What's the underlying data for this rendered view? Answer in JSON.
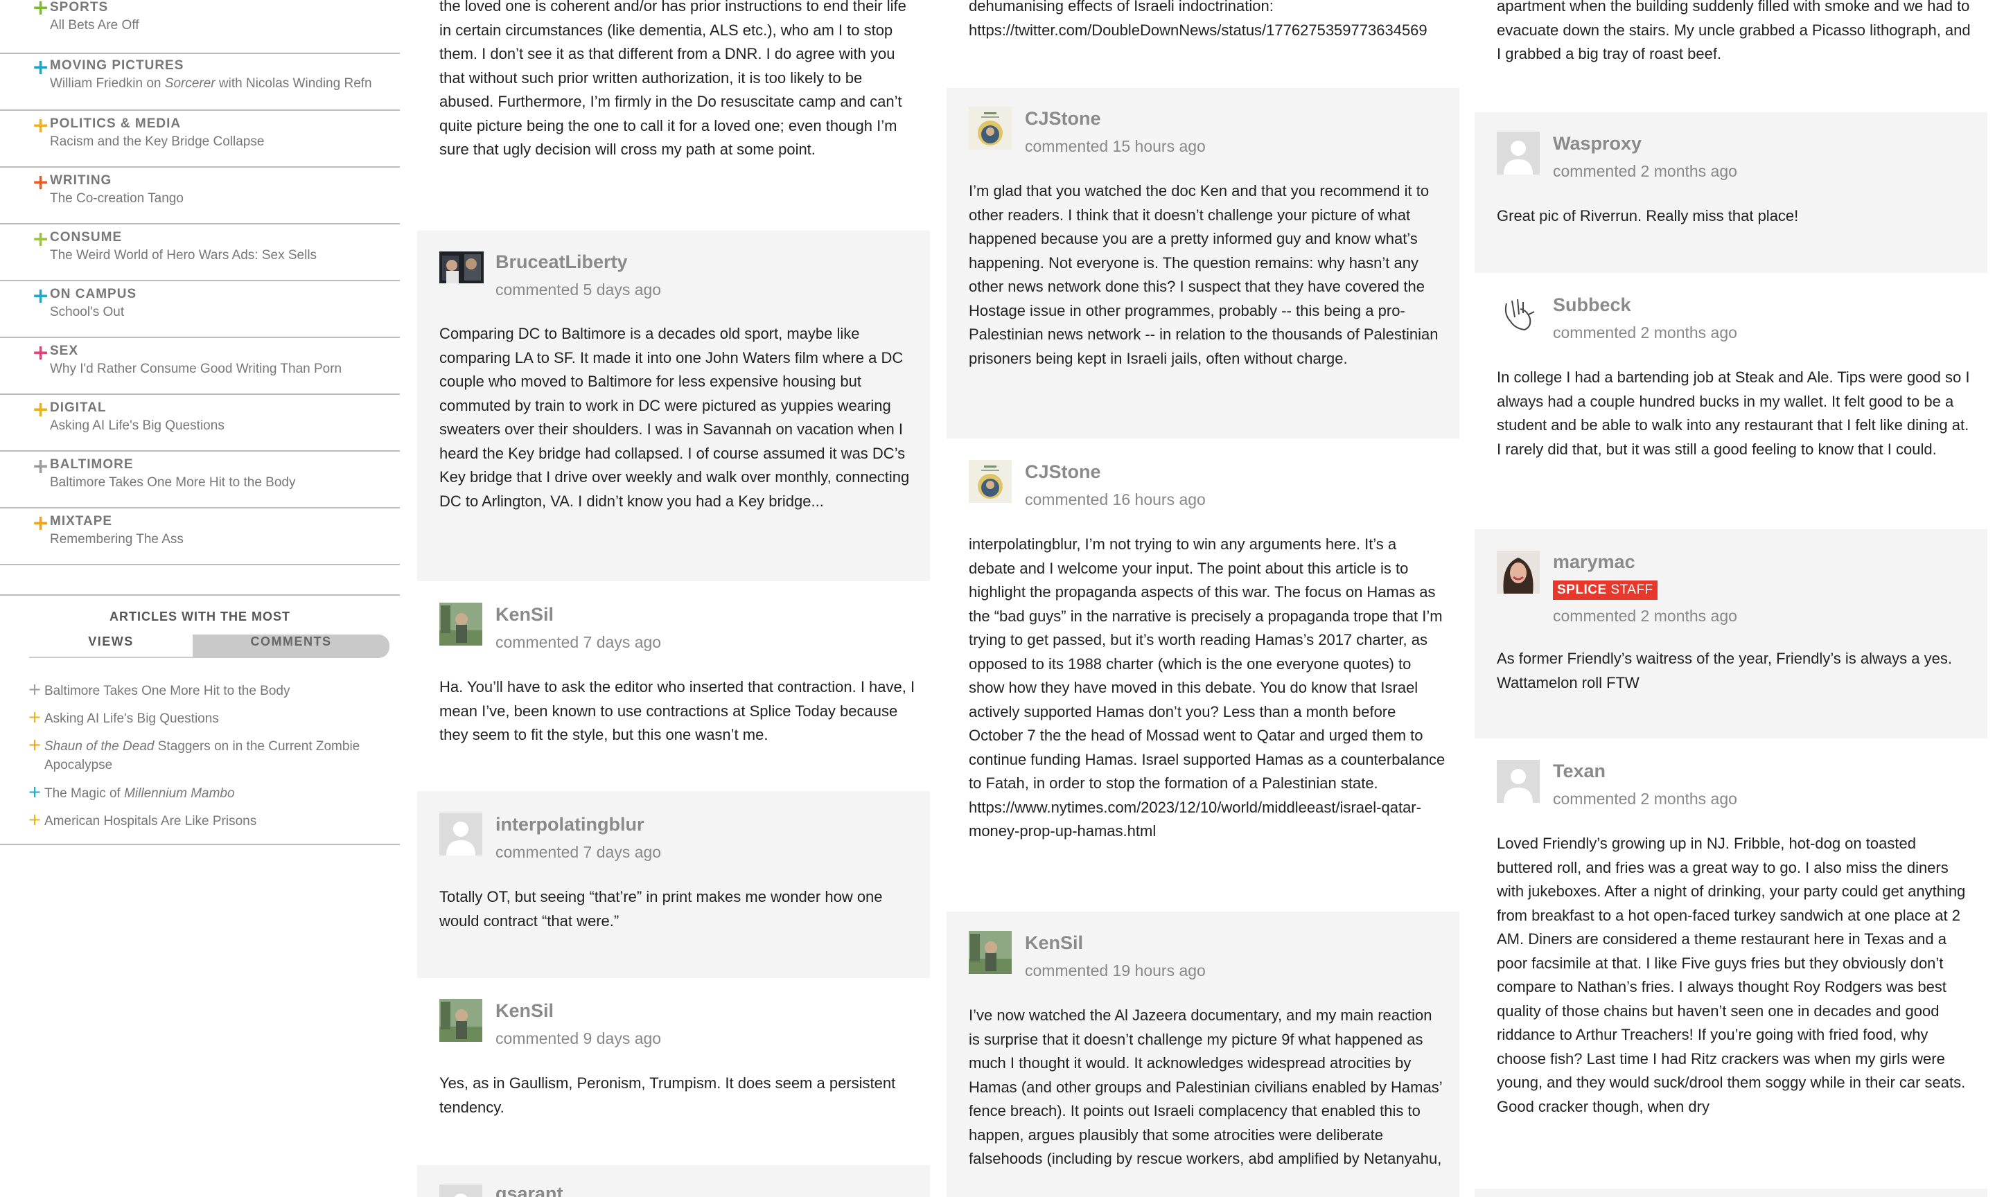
{
  "sidebar": {
    "sections": [
      {
        "category": "SPORTS",
        "title": "All Bets Are Off",
        "accent": "#7cba2f"
      },
      {
        "category": "MOVING PICTURES",
        "title_pre": "William Friedkin on ",
        "title_em": "Sorcerer",
        "title_post": " with Nicolas Winding Refn",
        "accent": "#1aa6c9"
      },
      {
        "category": "POLITICS & MEDIA",
        "title": "Racism and the Key Bridge Collapse",
        "accent": "#f2b01e"
      },
      {
        "category": "WRITING",
        "title": "The Co-creation Tango",
        "accent": "#ef5a24"
      },
      {
        "category": "CONSUME",
        "title": "The Weird World of Hero Wars Ads: Sex Sells",
        "accent": "#9ac53e"
      },
      {
        "category": "ON CAMPUS",
        "title": "School's Out",
        "accent": "#22a7c4"
      },
      {
        "category": "SEX",
        "title": "Why I'd Rather Consume Good Writing Than Porn",
        "accent": "#e4407b"
      },
      {
        "category": "DIGITAL",
        "title": "Asking AI Life's Big Questions",
        "accent": "#e8b312"
      },
      {
        "category": "BALTIMORE",
        "title": "Baltimore Takes One More Hit to the Body",
        "accent": "#9a9a9a"
      },
      {
        "category": "MIXTAPE",
        "title": "Remembering The Ass",
        "accent": "#f0a21b"
      }
    ],
    "most": {
      "heading": "ARTICLES WITH THE MOST",
      "tabs": [
        "VIEWS",
        "COMMENTS"
      ],
      "items": [
        {
          "text": "Baltimore Takes One More Hit to the Body",
          "accent": "#9a9a9a"
        },
        {
          "text": "Asking AI Life's Big Questions",
          "accent": "#e8b312"
        },
        {
          "em": "Shaun of the Dead",
          "text": " Staggers on in the Current Zombie Apocalypse",
          "accent": "#f0a21b"
        },
        {
          "pre": "The Magic of ",
          "em": "Millennium Mambo",
          "text": "",
          "accent": "#1aa6c9"
        },
        {
          "text": "American Hospitals Are Like Prisons",
          "accent": "#e8b312"
        }
      ]
    }
  },
  "col1": {
    "top_text": "the loved one is coherent and/or has prior instructions to end their life in certain circumstances (like dementia, ALS etc.), who am I to stop them. I don’t see it as that different from a DNR. I do agree with you that without such prior written authorization, it is too likely to be abused. Furthermore, I’m firmly in the Do resuscitate camp and can’t quite picture being the one to call it for a loved one; even though I’m sure that ugly decision will cross my path at some point.",
    "comments": [
      {
        "user": "BruceatLiberty",
        "time": "commented 5 days ago",
        "text": "Comparing DC to Baltimore is a decades old sport, maybe like comparing LA to SF. It made it into one John Waters film where a DC couple who moved to Baltimore for less expensive housing but commuted by train to work in DC were pictured as yuppies wearing sweaters over their shoulders. I was in Savannah on vacation when I heard the Key bridge had collapsed. I of course assumed it was DC’s Key bridge that I drive over weekly and walk over monthly, connecting DC to Arlington, VA. I didn’t know you had a Key bridge..."
      },
      {
        "user": "KenSil",
        "time": "commented 7 days ago",
        "text": "Ha. You’ll have to ask the editor who inserted that contraction. I have, I mean I’ve, been known to use contractions at Splice Today because they seem to fit the style, but this one wasn’t me."
      },
      {
        "user": "interpolatingblur",
        "time": "commented 7 days ago",
        "text": "Totally OT, but seeing “that’re” in print makes me wonder how one would contract “that were.”"
      },
      {
        "user": "KenSil",
        "time": "commented 9 days ago",
        "text": "Yes, as in Gaullism, Peronism, Trumpism. It does seem a persistent tendency."
      },
      {
        "user": "gsarant",
        "time": "",
        "text": ""
      }
    ]
  },
  "col2": {
    "top_text": "dehumanising effects of Israeli indoctrination: https://twitter.com/DoubleDownNews/status/1776275359773634569",
    "comments": [
      {
        "user": "CJStone",
        "time": "commented 15 hours ago",
        "text": "I’m glad that you watched the doc Ken and that you recommend it to other readers. I think that it doesn’t challenge your picture of what happened because you are a pretty informed guy and know what’s happening. Not everyone is. The question remains: why hasn’t any other news network done this? I suspect that they have covered the Hostage issue in other programmes, probably -- this being a pro-Palestinian news network -- in relation to the thousands of Palestinian prisoners being kept in Israeli jails, often without charge."
      },
      {
        "user": "CJStone",
        "time": "commented 16 hours ago",
        "text": "interpolatingblur, I’m not trying to win any arguments here. It’s a debate and I welcome your input. The point about this article is to highlight the propaganda aspects of this war. The focus on Hamas as the “bad guys” in the narrative is precisely a propaganda trope that I’m trying to get passed, but it’s worth reading Hamas’s 2017 charter, as opposed to its 1988 charter (which is the one everyone quotes) to show how they have moved in this debate. You do know that Israel actively supported Hamas don’t you? Less than a month before October 7 the the head of Mossad went to Qatar and urged them to continue funding Hamas. Israel supported Hamas as a counterbalance to Fatah, in order to stop the formation of a Palestinian state. https://www.nytimes.com/2023/12/10/world/middleeast/israel-qatar-money-prop-up-hamas.html"
      },
      {
        "user": "KenSil",
        "time": "commented 19 hours ago",
        "text": "I’ve now watched the Al Jazeera documentary, and my main reaction is surprise that it doesn’t challenge my picture 9f what happened as much I thought it would. It acknowledges widespread atrocities by Hamas (and other groups and Palestinian civilians enabled by Hamas’ fence breach). It points out Israeli complacency that enabled this to happen, argues plausibly that some atrocities were deliberate falsehoods (including by rescue workers, abd amplified by Netanyahu,"
      }
    ]
  },
  "col3": {
    "top_text": "apartment when the building suddenly filled with smoke and we had to evacuate down the stairs. My uncle grabbed a Picasso lithograph, and I grabbed a big tray of roast beef.",
    "comments": [
      {
        "user": "Wasproxy",
        "time": "commented 2 months ago",
        "text": "Great pic of Riverrun. Really miss that place!"
      },
      {
        "user": "Subbeck",
        "time": "commented 2 months ago",
        "text": "In college I had a bartending job at Steak and Ale. Tips were good so I always had a couple hundred bucks in my wallet. It felt good to be a student and be able to walk into any restaurant that I felt like dining at. I rarely did that, but it was still a good feeling to know that I could."
      },
      {
        "user": "marymac",
        "badge_a": "SPLICE",
        "badge_b": "STAFF",
        "time": "commented 2 months ago",
        "text": "As former Friendly’s waitress of the year, Friendly’s is always a yes. Wattamelon roll FTW"
      },
      {
        "user": "Texan",
        "time": "commented 2 months ago",
        "text": "Loved Friendly’s growing up in NJ. Fribble, hot-dog on toasted buttered roll, and fries was a great way to go. I also miss the diners with jukeboxes. After a night of drinking, your party could get anything from breakfast to a hot open-faced turkey sandwich at one place at 2 AM. Diners are considered a theme restaurant here in Texas and a poor facsimile at that. I like Five guys fries but they obviously don’t compare to Nathan’s fries. I always thought Roy Rodgers was best quality of those chains but haven’t seen one in decades and good riddance to Arthur Treachers! If you’re going with fried food, why choose fish? Last time I had Ritz crackers was when my girls were young, and they would suck/drool them soggy while in their car seats. Good cracker though, when dry"
      }
    ]
  }
}
